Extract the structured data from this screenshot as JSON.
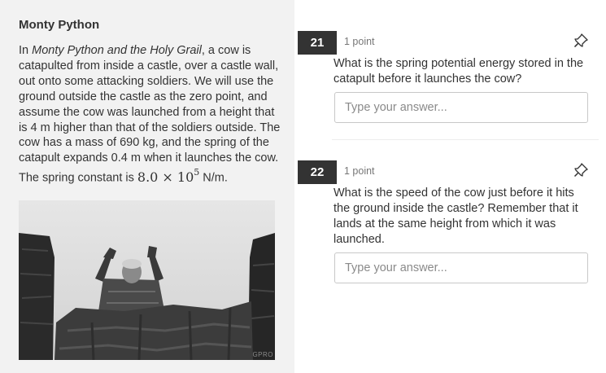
{
  "passage": {
    "title": "Monty Python",
    "intro": "In ",
    "film": "Monty Python and the Holy Grail",
    "body": ", a cow is catapulted from inside a castle, over a castle wall, out onto some attacking soldiers. We will use the ground outside the castle as the zero point, and assume the cow was launched from a height that is 4 m higher than that of the soldiers outside. The cow has a mass of 690 kg, and the spring of the catapult expands 0.4 m when it launches the cow. The spring constant is ",
    "k_mantissa": "8.0",
    "k_times": " × 10",
    "k_exponent": "5",
    "k_unit": " N/m.",
    "image_watermark": "GPRO"
  },
  "questions": [
    {
      "number": "21",
      "points": "1 point",
      "text": "What is the spring potential energy stored in the catapult before it launches the cow?",
      "placeholder": "Type your answer...",
      "value": "",
      "pin_icon": "pin-icon"
    },
    {
      "number": "22",
      "points": "1 point",
      "text": "What is the speed of the cow just before it hits the ground inside the castle? Remember that it lands at the same height from which it was launched.",
      "placeholder": "Type your answer...",
      "value": "",
      "pin_icon": "pin-icon"
    }
  ],
  "colors": {
    "left_panel_bg": "#f2f2f2",
    "number_badge_bg": "#333333",
    "text": "#333333",
    "muted": "#777777"
  }
}
